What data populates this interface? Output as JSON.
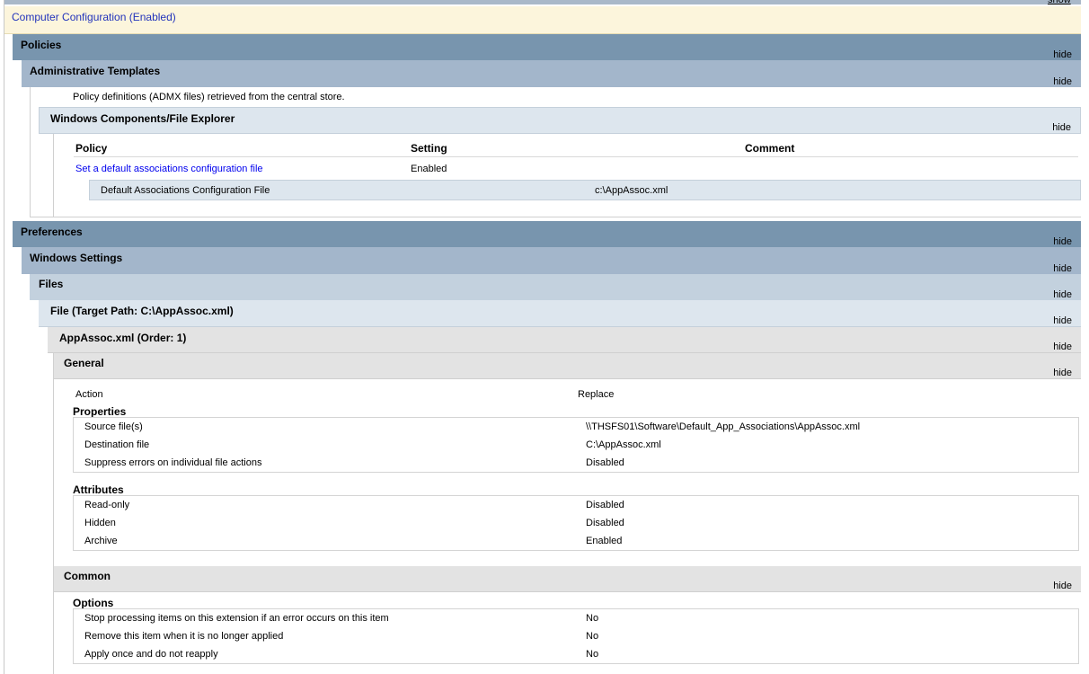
{
  "top": {
    "show_label": "show"
  },
  "computer_config": {
    "title": "Computer Configuration (Enabled)"
  },
  "policies": {
    "title": "Policies",
    "hide": "hide"
  },
  "admin_templates": {
    "title": "Administrative Templates",
    "hide": "hide",
    "description": "Policy definitions (ADMX files) retrieved from the central store."
  },
  "file_explorer": {
    "title": "Windows Components/File Explorer",
    "hide": "hide",
    "columns": {
      "policy": "Policy",
      "setting": "Setting",
      "comment": "Comment"
    },
    "row": {
      "policy": "Set a default associations configuration file",
      "setting": "Enabled"
    },
    "sub": {
      "label": "Default Associations Configuration File",
      "value": "c:\\AppAssoc.xml"
    }
  },
  "preferences": {
    "title": "Preferences",
    "hide": "hide"
  },
  "windows_settings": {
    "title": "Windows Settings",
    "hide": "hide"
  },
  "files": {
    "title": "Files",
    "hide": "hide"
  },
  "file_target": {
    "title": "File (Target Path: C:\\AppAssoc.xml)",
    "hide": "hide"
  },
  "appassoc": {
    "title": "AppAssoc.xml (Order: 1)",
    "hide": "hide"
  },
  "general": {
    "title": "General",
    "hide": "hide",
    "action_label": "Action",
    "action_value": "Replace",
    "properties_title": "Properties",
    "properties": [
      {
        "label": "Source file(s)",
        "value": "\\\\THSFS01\\Software\\Default_App_Associations\\AppAssoc.xml"
      },
      {
        "label": "Destination file",
        "value": "C:\\AppAssoc.xml"
      },
      {
        "label": "Suppress errors on individual file actions",
        "value": "Disabled"
      }
    ],
    "attributes_title": "Attributes",
    "attributes": [
      {
        "label": "Read-only",
        "value": "Disabled"
      },
      {
        "label": "Hidden",
        "value": "Disabled"
      },
      {
        "label": "Archive",
        "value": "Enabled"
      }
    ]
  },
  "common": {
    "title": "Common",
    "hide": "hide",
    "options_title": "Options",
    "options": [
      {
        "label": "Stop processing items on this extension if an error occurs on this item",
        "value": "No"
      },
      {
        "label": "Remove this item when it is no longer applied",
        "value": "No"
      },
      {
        "label": "Apply once and do not reapply",
        "value": "No"
      }
    ]
  }
}
